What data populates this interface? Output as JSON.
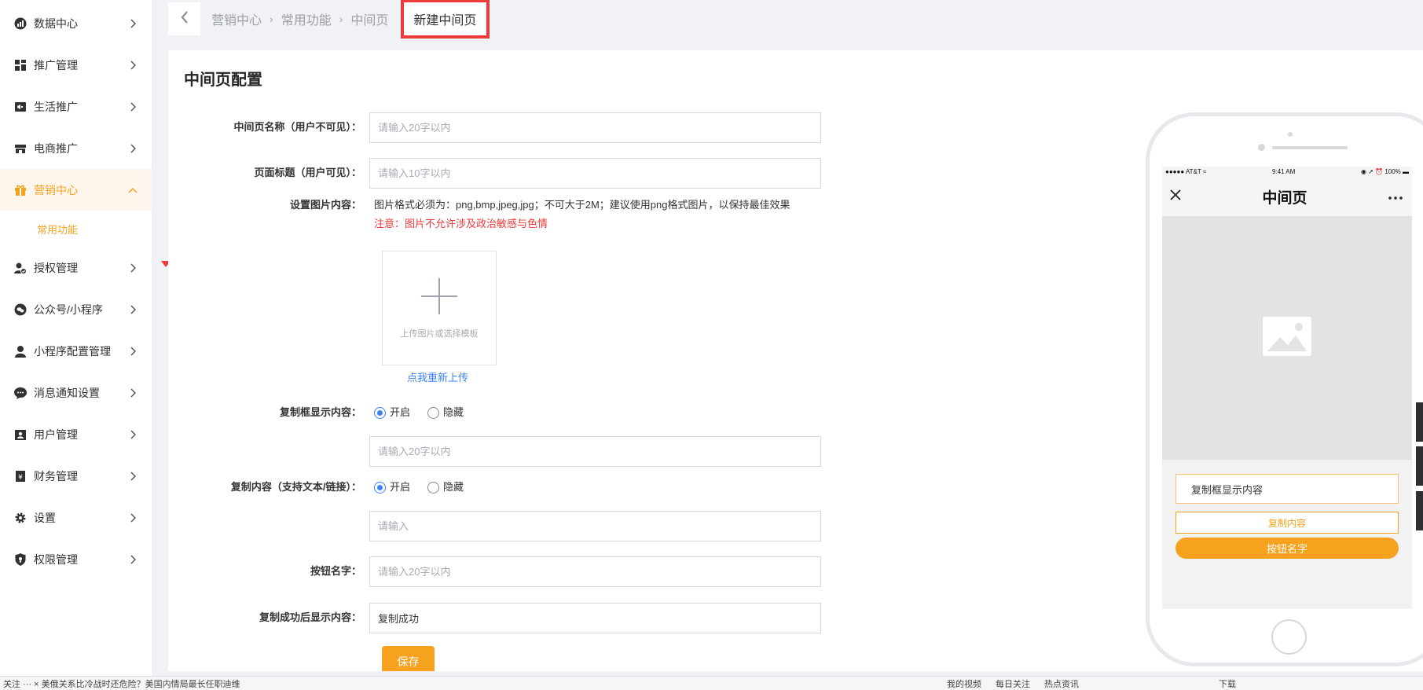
{
  "sidebar": {
    "items": [
      {
        "label": "数据中心",
        "icon": "chart-pie-icon"
      },
      {
        "label": "推广管理",
        "icon": "grid-icon"
      },
      {
        "label": "生活推广",
        "icon": "megaphone-icon"
      },
      {
        "label": "电商推广",
        "icon": "store-icon"
      },
      {
        "label": "营销中心",
        "icon": "gift-icon"
      },
      {
        "label": "授权管理",
        "icon": "user-check-icon"
      },
      {
        "label": "公众号/小程序",
        "icon": "chat-bubble-icon"
      },
      {
        "label": "小程序配置管理",
        "icon": "user-icon"
      },
      {
        "label": "消息通知设置",
        "icon": "message-icon"
      },
      {
        "label": "用户管理",
        "icon": "user-card-icon"
      },
      {
        "label": "财务管理",
        "icon": "wallet-icon"
      },
      {
        "label": "设置",
        "icon": "gear-icon"
      },
      {
        "label": "权限管理",
        "icon": "shield-icon"
      }
    ],
    "submenu": {
      "label": "常用功能"
    }
  },
  "breadcrumb": {
    "items": [
      "营销中心",
      "常用功能",
      "中间页"
    ],
    "separator": "›",
    "current": "新建中间页"
  },
  "form": {
    "title": "中间页配置",
    "name_label": "中间页名称（用户不可见）：",
    "name_placeholder": "请输入20字以内",
    "page_title_label": "页面标题（用户可见）：",
    "page_title_placeholder": "请输入10字以内",
    "image_label": "设置图片内容：",
    "image_note": "图片格式必须为：png,bmp,jpeg,jpg；不可大于2M；建议使用png格式图片，以保持最佳效果",
    "image_warn": "注意：图片不允许涉及政治敏感与色情",
    "upload_text": "上传图片或选择模板",
    "reupload": "点我重新上传",
    "copybox_label": "复制框显示内容：",
    "copybox_on": "开启",
    "copybox_off": "隐藏",
    "copybox_placeholder": "请输入20字以内",
    "copy_label": "复制内容（支持文本/链接）：",
    "copy_on": "开启",
    "copy_off": "隐藏",
    "copy_placeholder": "请输入",
    "button_label": "按钮名字：",
    "button_placeholder": "请输入20字以内",
    "success_label": "复制成功后显示内容：",
    "success_value": "复制成功",
    "save": "保存"
  },
  "preview": {
    "carrier": "●●●●● AT&T ≈",
    "time": "9:41 AM",
    "battery": "◉ ➚ ⏰ 100% ▬",
    "title": "中间页",
    "copybox": "复制框显示内容",
    "copy_content": "复制内容",
    "button": "按钮名字"
  },
  "bottombar": {
    "news": "关注 ··· × 美俄关系比冷战时还危险？美国内情局最长任职迪维",
    "links": [
      "我的视频",
      "每日关注",
      "热点资讯",
      "下载"
    ]
  },
  "colors": {
    "accent": "#f7a21e",
    "link": "#3b82f6",
    "warn": "#ef3a3a"
  }
}
